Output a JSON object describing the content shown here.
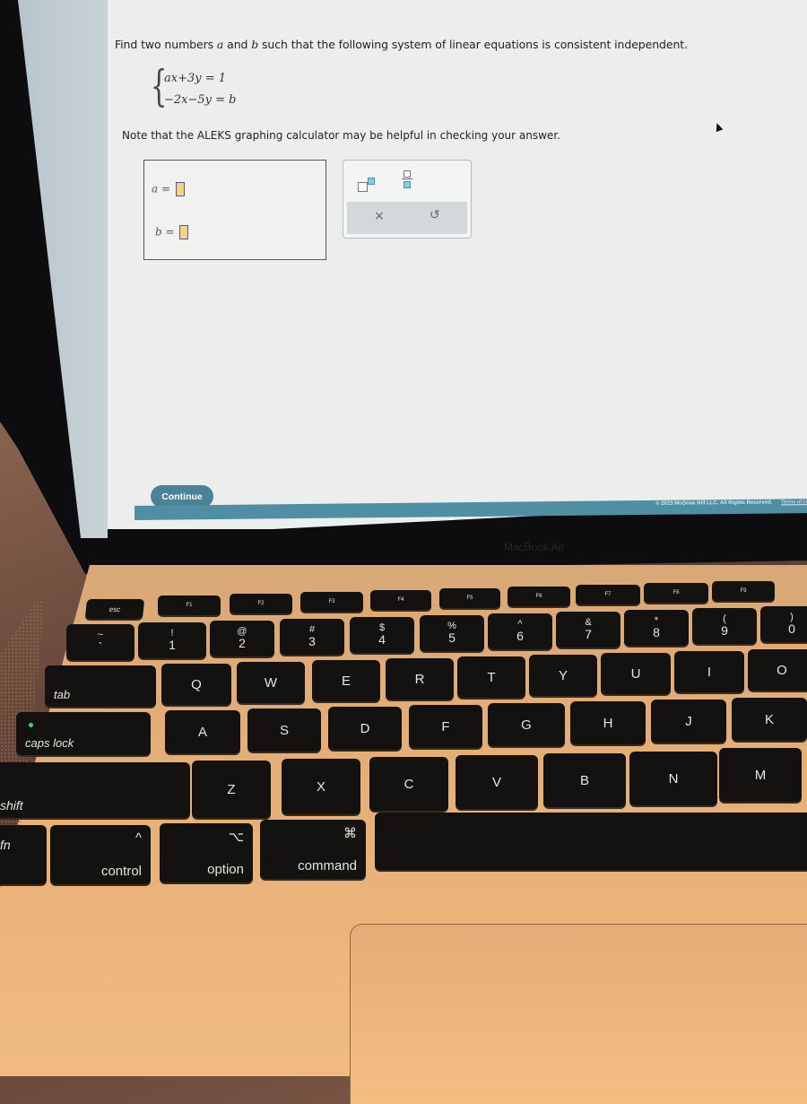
{
  "question": {
    "prefix": "Find two numbers ",
    "var_a": "a",
    "middle": " and ",
    "var_b": "b",
    "suffix": " such that the following system of linear equations is consistent independent.",
    "equations": [
      "ax+3y  = 1",
      "−2x−5y = b"
    ],
    "note": "Note that the ALEKS graphing calculator may be helpful in checking your answer."
  },
  "answer": {
    "a_label": "a =",
    "b_label": "b =",
    "a_value": "",
    "b_value": ""
  },
  "tools": {
    "superscript_icon": "superscript-icon",
    "fraction_icon": "fraction-icon",
    "clear_label": "×",
    "undo_label": "↺"
  },
  "actions": {
    "continue_label": "Continue"
  },
  "footer": {
    "copyright": "© 2023 McGraw Hill LLC. All Rights Reserved.",
    "terms": "Terms of U"
  },
  "device": {
    "brand": "MacBook Air"
  },
  "keyboard": {
    "fn_row": [
      "esc",
      "F1",
      "F2",
      "F3",
      "F4",
      "F5",
      "F6",
      "F7",
      "F8",
      "F9"
    ],
    "number_row": [
      {
        "top": "~",
        "bot": "`"
      },
      {
        "top": "!",
        "bot": "1"
      },
      {
        "top": "@",
        "bot": "2"
      },
      {
        "top": "#",
        "bot": "3"
      },
      {
        "top": "$",
        "bot": "4"
      },
      {
        "top": "%",
        "bot": "5"
      },
      {
        "top": "^",
        "bot": "6"
      },
      {
        "top": "&",
        "bot": "7"
      },
      {
        "top": "*",
        "bot": "8"
      },
      {
        "top": "(",
        "bot": "9"
      },
      {
        "top": ")",
        "bot": "0"
      }
    ],
    "qwerty_row": [
      "tab",
      "Q",
      "W",
      "E",
      "R",
      "T",
      "Y",
      "U",
      "I",
      "O"
    ],
    "home_row": [
      "caps lock",
      "A",
      "S",
      "D",
      "F",
      "G",
      "H",
      "J",
      "K"
    ],
    "bottom_row": [
      "shift",
      "Z",
      "X",
      "C",
      "V",
      "B",
      "N",
      "M"
    ],
    "modifier_row": [
      {
        "label": "fn",
        "symbol": ""
      },
      {
        "label": "control",
        "symbol": "^"
      },
      {
        "label": "option",
        "symbol": "⌥"
      },
      {
        "label": "command",
        "symbol": "⌘"
      }
    ]
  },
  "colors": {
    "accent": "#4a8397",
    "footer_bar": "#4f8ea3",
    "input_slot": "#f2d77a",
    "input_border": "#5b4fa8",
    "tool_highlight": "#7dd0df"
  }
}
